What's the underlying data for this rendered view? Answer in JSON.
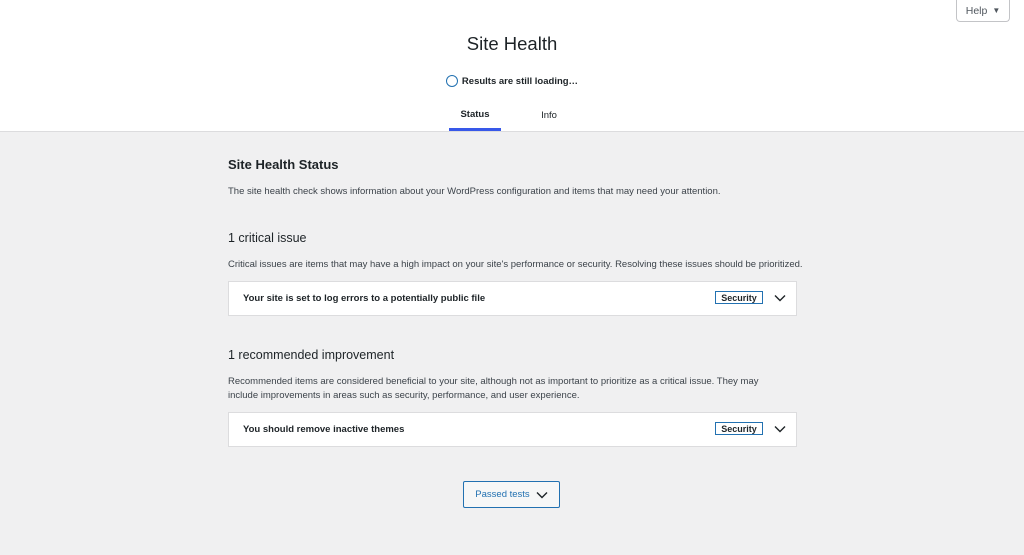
{
  "help_label": "Help",
  "page_title": "Site Health",
  "loading_text": "Results are still loading…",
  "tabs": [
    {
      "label": "Status"
    },
    {
      "label": "Info"
    }
  ],
  "section": {
    "title": "Site Health Status",
    "description": "The site health check shows information about your WordPress configuration and items that may need your attention."
  },
  "critical": {
    "heading": "1 critical issue",
    "description": "Critical issues are items that may have a high impact on your site's performance or security. Resolving these issues should be prioritized.",
    "items": [
      {
        "title": "Your site is set to log errors to a potentially public file",
        "badge": "Security"
      }
    ]
  },
  "recommended": {
    "heading": "1 recommended improvement",
    "description": "Recommended items are considered beneficial to your site, although not as important to prioritize as a critical issue. They may include improvements in areas such as security, performance, and user experience.",
    "items": [
      {
        "title": "You should remove inactive themes",
        "badge": "Security"
      }
    ]
  },
  "passed_tests_label": "Passed tests",
  "colors": {
    "accent": "#2271b1",
    "tab_active": "#3858e9",
    "background": "#f0f0f1"
  }
}
